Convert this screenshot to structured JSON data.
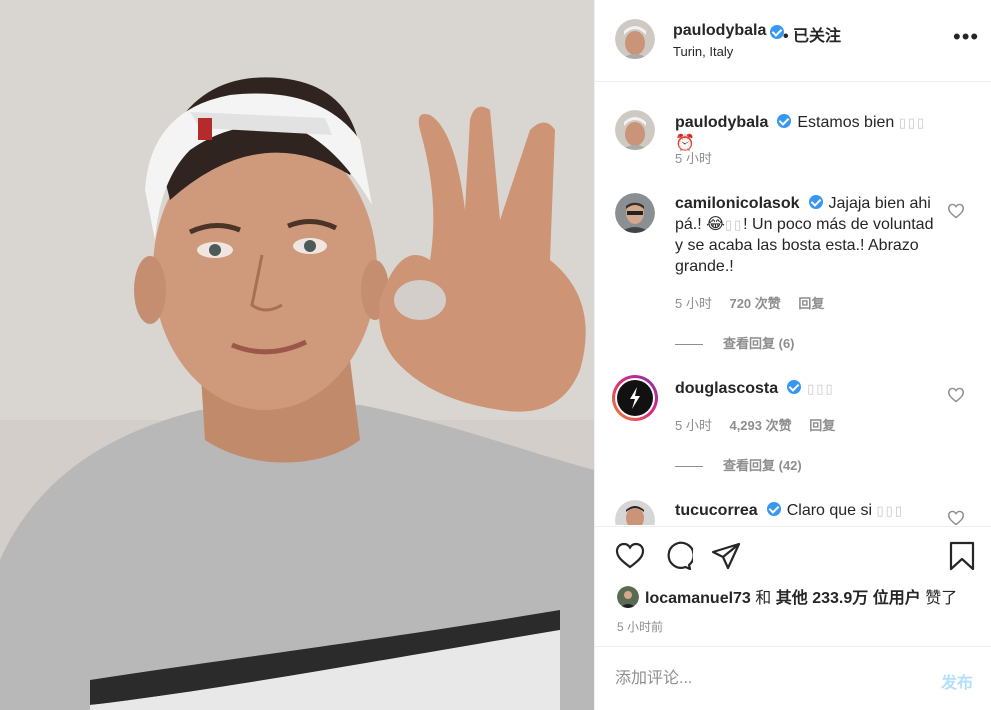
{
  "colors": {
    "verified": "#3897f0",
    "post_disabled": "#b2dffc",
    "muted": "#8e8e8e",
    "text": "#262626"
  },
  "header": {
    "username": "paulodybala",
    "follow_status": "• 已关注",
    "location": "Turin, Italy",
    "more_icon": "more-horizontal-icon"
  },
  "caption": {
    "username": "paulodybala",
    "text": "Estamos bien",
    "emoji_tail": "⏰",
    "time": "5 小时"
  },
  "comments": [
    {
      "username": "camilonicolasok",
      "text": "Jajaja bien ahi pá.! 😂",
      "text_rest": "! Un poco más de voluntad y se acaba las bosta esta.! Abrazo grande.!",
      "time": "5 小时",
      "likes": "720 次赞",
      "reply": "回复",
      "view_replies": "查看回复 (6)"
    },
    {
      "username": "douglascosta",
      "text": "",
      "time": "5 小时",
      "likes": "4,293 次赞",
      "reply": "回复",
      "view_replies": "查看回复 (42)"
    },
    {
      "username": "tucucorrea",
      "text": "Claro que si"
    }
  ],
  "actions": {
    "like_icon": "heart-icon",
    "comment_icon": "comment-icon",
    "share_icon": "share-icon",
    "save_icon": "bookmark-icon"
  },
  "likes": {
    "user": "locamanuel73",
    "and": "和",
    "others": "其他",
    "count": "233.9万",
    "unit": "位用户",
    "suffix": "赞了"
  },
  "post_time": "5 小时前",
  "add_comment": {
    "placeholder": "添加评论...",
    "post_label": "发布"
  }
}
